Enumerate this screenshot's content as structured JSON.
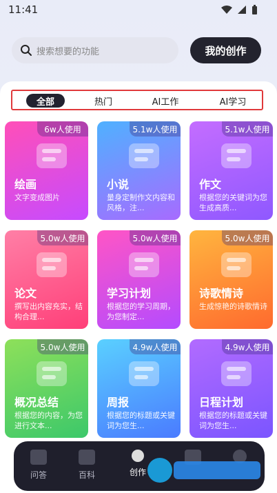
{
  "status": {
    "time": "11:41"
  },
  "header": {
    "search_placeholder": "搜索想要的功能",
    "create_button": "我的创作"
  },
  "tabs": [
    {
      "label": "全部"
    },
    {
      "label": "热门"
    },
    {
      "label": "AI工作"
    },
    {
      "label": "AI学习"
    }
  ],
  "cards": [
    {
      "title": "绘画",
      "desc": "文字变成图片",
      "usage": "6w人使用",
      "grad": [
        "#ff4fb8",
        "#c64bff"
      ]
    },
    {
      "title": "小说",
      "desc": "量身定制作文内容和风格，注...",
      "usage": "5.1w人使用",
      "grad": [
        "#4fb1ff",
        "#a76bff"
      ]
    },
    {
      "title": "作文",
      "desc": "根据您的关键词为您生成高质...",
      "usage": "5.1w人使用",
      "grad": [
        "#c46dff",
        "#8f58ff"
      ]
    },
    {
      "title": "论文",
      "desc": "撰写出内容充实，结构合理...",
      "usage": "5.0w人使用",
      "grad": [
        "#ff7fa6",
        "#ff3f79"
      ]
    },
    {
      "title": "学习计划",
      "desc": "根据您的学习周期，为您制定...",
      "usage": "5.0w人使用",
      "grad": [
        "#ff55c5",
        "#b44bff"
      ]
    },
    {
      "title": "诗歌情诗",
      "desc": "生成惊艳的诗歌情诗",
      "usage": "5.0w人使用",
      "grad": [
        "#ffb53f",
        "#ff6a2e"
      ]
    },
    {
      "title": "概况总结",
      "desc": "根据您的内容，为您进行文本...",
      "usage": "5.0w人使用",
      "grad": [
        "#8ee05a",
        "#3cc86a"
      ]
    },
    {
      "title": "周报",
      "desc": "根据您的标题或关键词为您生...",
      "usage": "4.9w人使用",
      "grad": [
        "#5ad0ff",
        "#4a7bff"
      ]
    },
    {
      "title": "日程计划",
      "desc": "根据您的标题或关键词为您生...",
      "usage": "4.9w人使用",
      "grad": [
        "#b26bff",
        "#7b55ff"
      ]
    }
  ],
  "nav": [
    {
      "label": "问答"
    },
    {
      "label": "百科"
    },
    {
      "label": "创作"
    }
  ]
}
